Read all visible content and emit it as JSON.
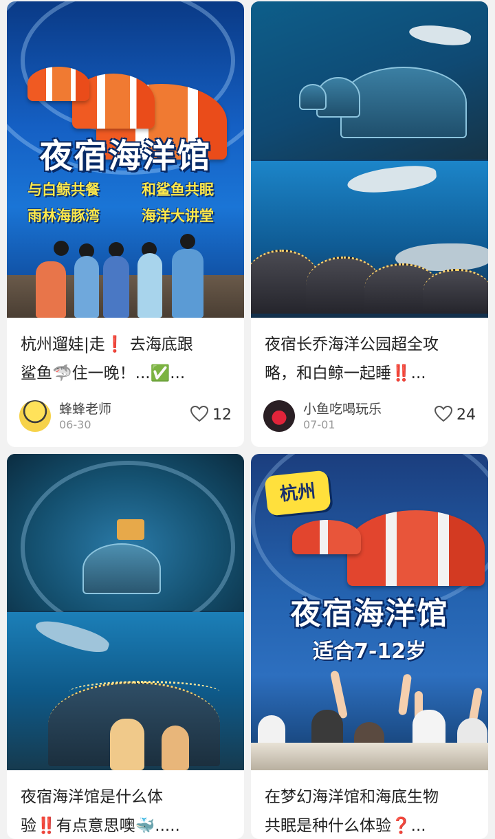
{
  "cards": [
    {
      "image": {
        "headline": "夜宿海洋馆",
        "tags": [
          "与白鲸共餐",
          "和鲨鱼共眠",
          "雨林海豚湾",
          "海洋大讲堂"
        ]
      },
      "title_line1": "杭州遛娃|走❗ 去海底跟",
      "title_line2": "鲨鱼🦈住一晚！...✅...",
      "author": "蜂蜂老师",
      "date": "06-30",
      "likes": "12"
    },
    {
      "title_line1": "夜宿长乔海洋公园超全攻",
      "title_line2": "略，和白鲸一起睡‼️...",
      "author": "小鱼吃喝玩乐",
      "date": "07-01",
      "likes": "24"
    },
    {
      "title_line1": "夜宿海洋馆是什么体",
      "title_line2": "验‼️有点意思噢🐳.....",
      "author": "",
      "date": "",
      "likes": ""
    },
    {
      "image": {
        "badge": "杭州",
        "headline": "夜宿海洋馆",
        "subline": "适合7-12岁"
      },
      "title_line1": "在梦幻海洋馆和海底生物",
      "title_line2": "共眠是种什么体验❓...",
      "author": "",
      "date": "",
      "likes": ""
    }
  ],
  "colors": {
    "background": "#f2f2f2",
    "card": "#ffffff",
    "accent_yellow": "#ffe94a"
  }
}
